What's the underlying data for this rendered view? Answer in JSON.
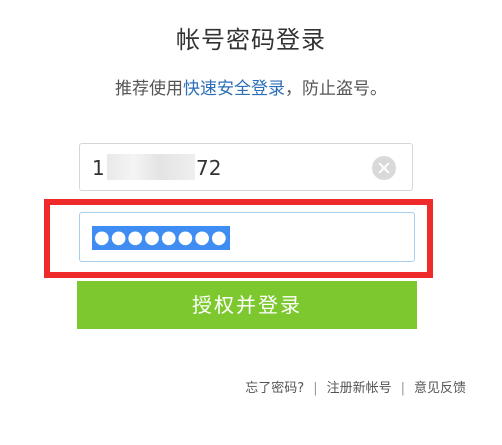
{
  "header": {
    "title": "帐号密码登录",
    "subtitle_prefix": "推荐使用",
    "subtitle_link": "快速安全登录",
    "subtitle_suffix": "，防止盗号。"
  },
  "form": {
    "account_prefix": "1",
    "account_suffix": "72",
    "password_mask": "●●●●●●●●",
    "submit_label": "授权并登录"
  },
  "footer": {
    "links": [
      "忘了密码?",
      "注册新帐号",
      "意见反馈"
    ],
    "separator": "|"
  },
  "colors": {
    "button_green": "#7dc82e",
    "link_blue": "#2d6fb6",
    "highlight_red": "#ee2a2a",
    "selection_blue": "#3f8cf2"
  }
}
